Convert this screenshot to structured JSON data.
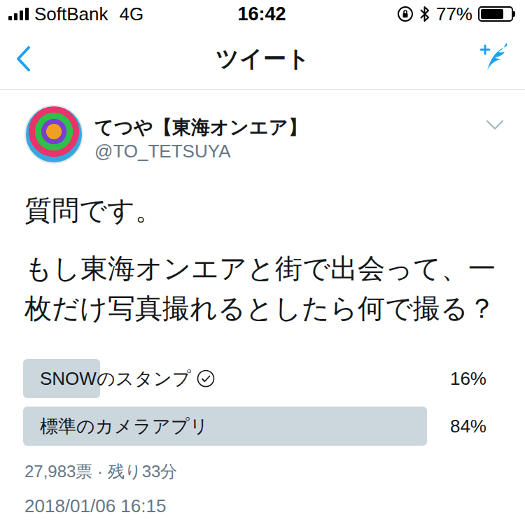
{
  "status_bar": {
    "carrier": "SoftBank",
    "network": "4G",
    "signal": 1,
    "time": "16:42",
    "battery": "77%",
    "battery_level": 0.77
  },
  "nav": {
    "title": "ツイート"
  },
  "tweet": {
    "name": "てつや【東海オンエア】",
    "handle": "@TO_TETSUYA",
    "text": [
      "質問です。",
      "もし東海オンエアと街で出会って、一枚だけ写真撮れるとしたら何で撮る？"
    ]
  },
  "poll": {
    "options": [
      {
        "label": "SNOWのスタンプ",
        "percent": "16%",
        "level": 0.16,
        "selected": true
      },
      {
        "label": "標準のカメラアプリ",
        "percent": "84%",
        "level": 0.84,
        "selected": false
      }
    ],
    "meta": "27,983票 · 残り33分"
  },
  "timestamp": "2018/01/06 16:15"
}
